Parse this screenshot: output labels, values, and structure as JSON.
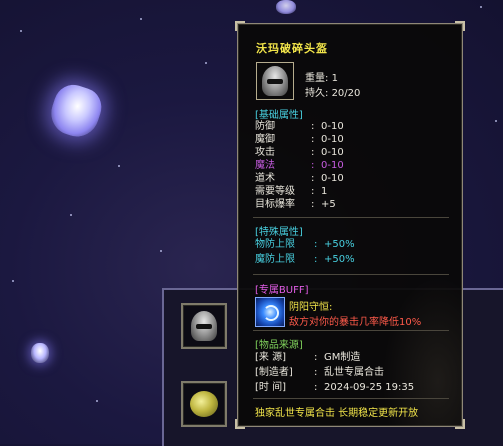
{
  "tooltip": {
    "item_name": "沃玛破碎头盔",
    "weight_label": "重量:",
    "weight_value": "1",
    "durability_label": "持久:",
    "durability_value": "20/20",
    "base_attrs_header": "[基础属性]",
    "base_attrs": [
      {
        "key": "防御",
        "sep": ":",
        "value": "0-10",
        "color": "normal"
      },
      {
        "key": "魔御",
        "sep": ":",
        "value": "0-10",
        "color": "normal"
      },
      {
        "key": "攻击",
        "sep": ":",
        "value": "0-10",
        "color": "normal"
      },
      {
        "key": "魔法",
        "sep": ":",
        "value": "0-10",
        "color": "purple"
      },
      {
        "key": "道术",
        "sep": ":",
        "value": "0-10",
        "color": "normal"
      },
      {
        "key": "需要等级",
        "sep": ":",
        "value": "1",
        "color": "normal"
      },
      {
        "key": "目标爆率",
        "sep": ":",
        "value": "+5",
        "color": "normal"
      }
    ],
    "special_attrs_header": "[特殊属性]",
    "special_attrs": [
      {
        "key": "物防上限",
        "sep": ":",
        "value": "+50%"
      },
      {
        "key": "魔防上限",
        "sep": ":",
        "value": "+50%"
      }
    ],
    "buff_header": "[专属BUFF]",
    "buff_name": "阴阳守恒:",
    "buff_desc": "敌方对你的暴击几率降低10%",
    "source_header": "[物品来源]",
    "source_rows": [
      {
        "key": "[来  源]",
        "sep": ":",
        "value": "GM制造"
      },
      {
        "key": "[制造者]",
        "sep": ":",
        "value": "乱世专属合击"
      },
      {
        "key": "[时  间]",
        "sep": ":",
        "value": "2024-09-25 19:35"
      }
    ],
    "footer": "独家乱世专属合击  长期稳定更新开放"
  },
  "colors": {
    "title": "#f2e54a",
    "section_cyan": "#48d0e0",
    "section_magenta": "#e25de6",
    "section_green": "#7fd05b",
    "buff_desc": "#ff5a4a",
    "magic_row": "#c65ce0"
  },
  "icons": {
    "item": "helmet-icon",
    "buff": "yin-yang-buff-icon",
    "equip_slot_1": "helmet-icon",
    "equip_slot_2": "jade-pendant-icon"
  }
}
